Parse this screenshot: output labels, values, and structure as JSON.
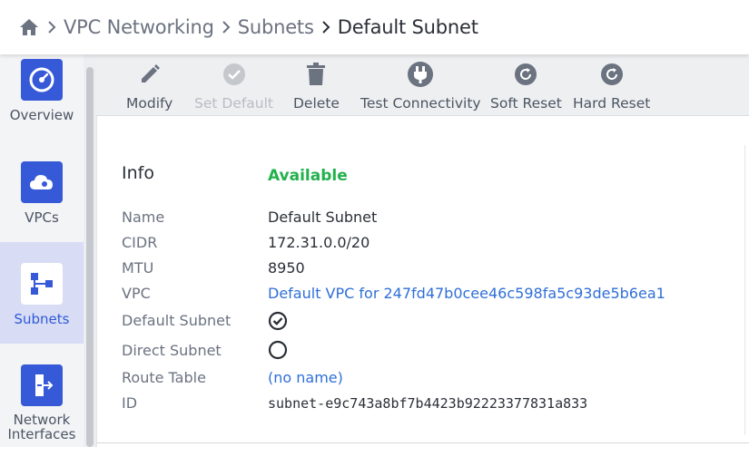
{
  "breadcrumb": {
    "home_icon": "home-icon",
    "items": [
      "VPC Networking",
      "Subnets",
      "Default Subnet"
    ]
  },
  "sidebar": {
    "items": [
      {
        "label": "Overview",
        "icon": "gauge-icon"
      },
      {
        "label": "VPCs",
        "icon": "cloud-icon"
      },
      {
        "label": "Subnets",
        "icon": "subnets-icon",
        "active": true
      },
      {
        "label": "Network\nInterfaces",
        "label_line1": "Network",
        "label_line2": "Interfaces",
        "icon": "network-interface-icon"
      }
    ]
  },
  "toolbar": {
    "modify": "Modify",
    "set_default": "Set Default",
    "delete": "Delete",
    "test_connectivity": "Test Connectivity",
    "soft_reset": "Soft Reset",
    "hard_reset": "Hard Reset"
  },
  "info": {
    "title": "Info",
    "status": "Available",
    "rows": {
      "name": {
        "label": "Name",
        "value": "Default Subnet"
      },
      "cidr": {
        "label": "CIDR",
        "value": "172.31.0.0/20"
      },
      "mtu": {
        "label": "MTU",
        "value": "8950"
      },
      "vpc": {
        "label": "VPC",
        "value": "Default VPC for 247fd47b0cee46c598fa5c93de5b6ea1"
      },
      "default_subnet": {
        "label": "Default Subnet",
        "checked": true
      },
      "direct_subnet": {
        "label": "Direct Subnet",
        "checked": false
      },
      "route_table": {
        "label": "Route Table",
        "value": "(no name)"
      },
      "id": {
        "label": "ID",
        "value": "subnet-e9c743a8bf7b4423b92223377831a833"
      }
    }
  },
  "colors": {
    "accent": "#3659d8",
    "status_green": "#22b14c",
    "link": "#2f6fd8",
    "active_nav_bg": "#d8dcf5"
  }
}
